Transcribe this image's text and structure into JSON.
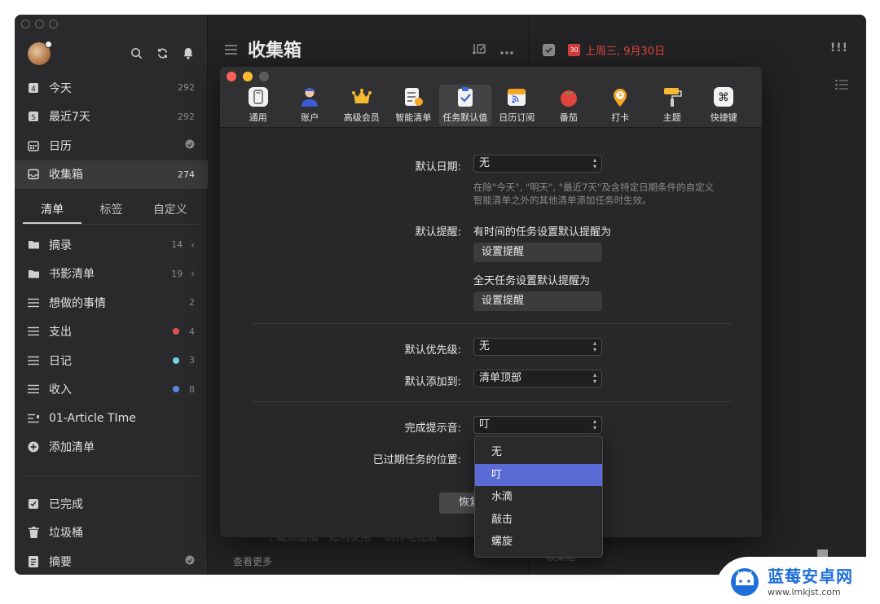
{
  "sidebar": {
    "nav": [
      {
        "label": "今天",
        "count": "292",
        "icon": "today-icon"
      },
      {
        "label": "最近7天",
        "count": "292",
        "icon": "week-icon"
      },
      {
        "label": "日历",
        "count": "",
        "icon": "calendar-icon"
      },
      {
        "label": "收集箱",
        "count": "274",
        "icon": "inbox-icon"
      }
    ],
    "segments": [
      "清单",
      "标签",
      "自定义"
    ],
    "lists": [
      {
        "label": "摘录",
        "count": "14",
        "icon": "folder-icon"
      },
      {
        "label": "书影清单",
        "count": "19",
        "icon": "folder-icon"
      },
      {
        "label": "想做的事情",
        "count": "2",
        "icon": "list-icon"
      },
      {
        "label": "支出",
        "count": "4",
        "icon": "list-icon",
        "color": "#e0534d"
      },
      {
        "label": "日记",
        "count": "3",
        "icon": "list-icon",
        "color": "#6fd6d9"
      },
      {
        "label": "收入",
        "count": "8",
        "icon": "list-icon",
        "color": "#5a86e8"
      },
      {
        "label": "01-Article TIme",
        "count": "",
        "icon": "shared-list-icon"
      },
      {
        "label": "添加清单",
        "count": "",
        "icon": "add-icon"
      }
    ],
    "bottom": [
      {
        "label": "已完成",
        "icon": "check-square-icon"
      },
      {
        "label": "垃圾桶",
        "icon": "trash-icon"
      },
      {
        "label": "摘要",
        "icon": "summary-icon"
      }
    ]
  },
  "pane": {
    "title": "收集箱",
    "footer": "查看更多",
    "ghost": "下载频道播 · 如何使用 ·· 制作电视故 ···"
  },
  "detail": {
    "date_badge": "30",
    "date": "上周三, 9月30日",
    "priority": "!!!",
    "footer_left": "收集箱"
  },
  "dialog": {
    "tabs": [
      {
        "label": "通用",
        "icon": "general-icon"
      },
      {
        "label": "账户",
        "icon": "account-icon"
      },
      {
        "label": "高级会员",
        "icon": "crown-icon"
      },
      {
        "label": "智能清单",
        "icon": "smart-list-icon"
      },
      {
        "label": "任务默认值",
        "icon": "task-defaults-icon"
      },
      {
        "label": "日历订阅",
        "icon": "calendar-subscribe-icon"
      },
      {
        "label": "番茄",
        "icon": "tomato-icon"
      },
      {
        "label": "打卡",
        "icon": "habit-icon"
      },
      {
        "label": "主题",
        "icon": "theme-icon"
      },
      {
        "label": "快捷键",
        "icon": "shortcut-icon"
      }
    ],
    "default_date_label": "默认日期:",
    "default_date_value": "无",
    "default_date_hint_1": "在除\"今天\", \"明天\", \"最近7天\"及含特定日期条件的自定义",
    "default_date_hint_2": "智能清单之外的其他清单添加任务时生效。",
    "reminder_label": "默认提醒:",
    "reminder_timed": "有时间的任务设置默认提醒为",
    "reminder_button": "设置提醒",
    "reminder_allday": "全天任务设置默认提醒为",
    "priority_label": "默认优先级:",
    "priority_value": "无",
    "add_to_label": "默认添加到:",
    "add_to_value": "清单顶部",
    "sound_label": "完成提示音:",
    "sound_value": "叮",
    "overdue_label": "已过期任务的位置:",
    "restore_button": "恢复",
    "sound_options": [
      "无",
      "叮",
      "水滴",
      "敲击",
      "螺旋"
    ]
  },
  "watermark": {
    "title": "蓝莓安卓网",
    "url": "www.lmkjst.com"
  }
}
